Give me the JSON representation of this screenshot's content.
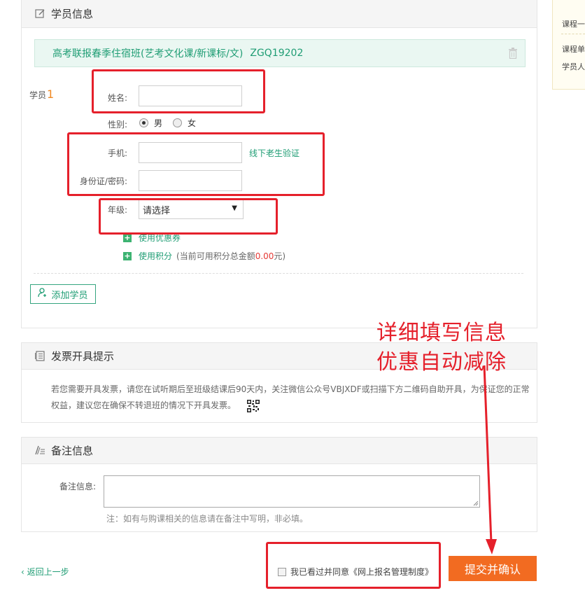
{
  "student_section": {
    "title": "学员信息",
    "course_name": "高考联报春季住宿班(艺考文化课/新课标/文)",
    "course_code": "ZGQ19202",
    "student_label": "学员",
    "student_number": "1",
    "name_label": "姓名:",
    "name_value": "",
    "gender_label": "性别:",
    "gender_male": "男",
    "gender_female": "女",
    "gender_selected": "男",
    "phone_label": "手机:",
    "phone_value": "",
    "verify_link": "线下老生验证",
    "id_label": "身份证/密码:",
    "id_value": "",
    "grade_label": "年级:",
    "grade_selected": "请选择",
    "coupon_label": "使用优惠券",
    "points_label": "使用积分",
    "points_note_prefix": "(当前可用积分总金额",
    "points_amount": "0.00",
    "points_note_suffix": "元)",
    "add_student_button": "添加学员"
  },
  "invoice_section": {
    "title": "发票开具提示",
    "text": "若您需要开具发票，请您在试听期后至班级结课后90天内，关注微信公众号VBJXDF或扫描下方二维码自助开具，为保证您的正常权益，建议您在确保不转退班的情况下开具发票。"
  },
  "remark_section": {
    "title": "备注信息",
    "label": "备注信息:",
    "value": "",
    "note": "注：如有与购课相关的信息请在备注中写明，非必填。"
  },
  "footer": {
    "back_link": "返回上一步",
    "agree_text": "我已看过并同意《网上报名管理制度》",
    "submit_button": "提交并确认"
  },
  "annotation": {
    "line1": "详细填写信息",
    "line2": "优惠自动减除"
  },
  "side_card": {
    "title": "课程一",
    "row1": "课程单",
    "row2": "学员人"
  },
  "colors": {
    "accent_green": "#1f9d74",
    "submit_orange": "#f26b21",
    "annotation_red": "#e5202b"
  }
}
